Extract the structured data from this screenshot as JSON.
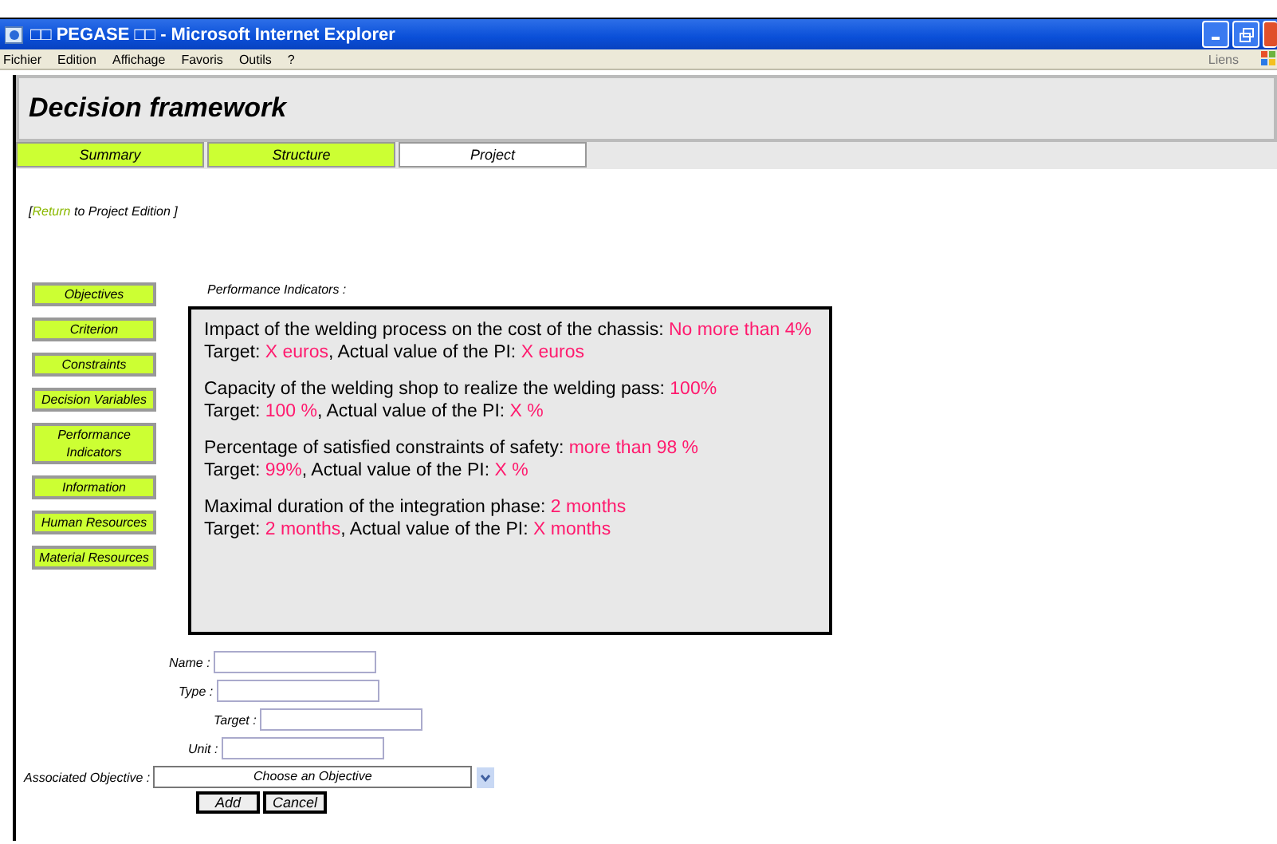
{
  "window": {
    "title": "□□ PEGASE □□ - Microsoft Internet Explorer"
  },
  "menu": [
    "Fichier",
    "Edition",
    "Affichage",
    "Favoris",
    "Outils",
    "?"
  ],
  "links_label": "Liens",
  "header": {
    "title": "Decision framework"
  },
  "tabs": [
    {
      "label": "Summary",
      "selected": false
    },
    {
      "label": "Structure",
      "selected": false
    },
    {
      "label": "Project",
      "selected": true
    }
  ],
  "return_line": {
    "before": "[",
    "link": "Return",
    "after": "to Project Edition ]"
  },
  "sidebar": {
    "items": [
      "Objectives",
      "Criterion",
      "Constraints",
      "Decision Variables",
      "Performance Indicators",
      "Information",
      "Human Resources",
      "Material Resources"
    ]
  },
  "panel": {
    "label": "Performance Indicators :",
    "indicators": [
      {
        "lines": [
          [
            {
              "text": "Impact of the welding process on the cost of the chassis: ",
              "highlight": false
            },
            {
              "text": "No more than 4%",
              "highlight": true
            }
          ],
          [
            {
              "text": "Target: ",
              "highlight": false
            },
            {
              "text": "X euros",
              "highlight": true
            },
            {
              "text": ", Actual value of the PI: ",
              "highlight": false
            },
            {
              "text": "X euros",
              "highlight": true
            }
          ]
        ]
      },
      {
        "lines": [
          [
            {
              "text": "Capacity of the welding shop to realize the welding pass: ",
              "highlight": false
            },
            {
              "text": "100%",
              "highlight": true
            }
          ],
          [
            {
              "text": "Target: ",
              "highlight": false
            },
            {
              "text": "100 %",
              "highlight": true
            },
            {
              "text": ", Actual value of the PI: ",
              "highlight": false
            },
            {
              "text": "X %",
              "highlight": true
            }
          ]
        ]
      },
      {
        "lines": [
          [
            {
              "text": "Percentage of satisfied constraints of safety: ",
              "highlight": false
            },
            {
              "text": "more than 98 %",
              "highlight": true
            }
          ],
          [
            {
              "text": "Target: ",
              "highlight": false
            },
            {
              "text": "99%",
              "highlight": true
            },
            {
              "text": ", Actual value of the PI: ",
              "highlight": false
            },
            {
              "text": "X %",
              "highlight": true
            }
          ]
        ]
      },
      {
        "lines": [
          [
            {
              "text": "Maximal duration of the integration phase: ",
              "highlight": false
            },
            {
              "text": "2 months",
              "highlight": true
            }
          ],
          [
            {
              "text": "Target: ",
              "highlight": false
            },
            {
              "text": "2 months",
              "highlight": true
            },
            {
              "text": ", Actual value of the PI: ",
              "highlight": false
            },
            {
              "text": "X months",
              "highlight": true
            }
          ]
        ]
      }
    ]
  },
  "form": {
    "fields": [
      {
        "label": "Name :",
        "kind": "text"
      },
      {
        "label": "Type :",
        "kind": "text"
      },
      {
        "label": "Target :",
        "kind": "text"
      },
      {
        "label": "Unit :",
        "kind": "text"
      },
      {
        "label": "Associated Objective :",
        "kind": "select",
        "value": "Choose an Objective"
      }
    ],
    "buttons": [
      "Add",
      "Cancel"
    ]
  }
}
